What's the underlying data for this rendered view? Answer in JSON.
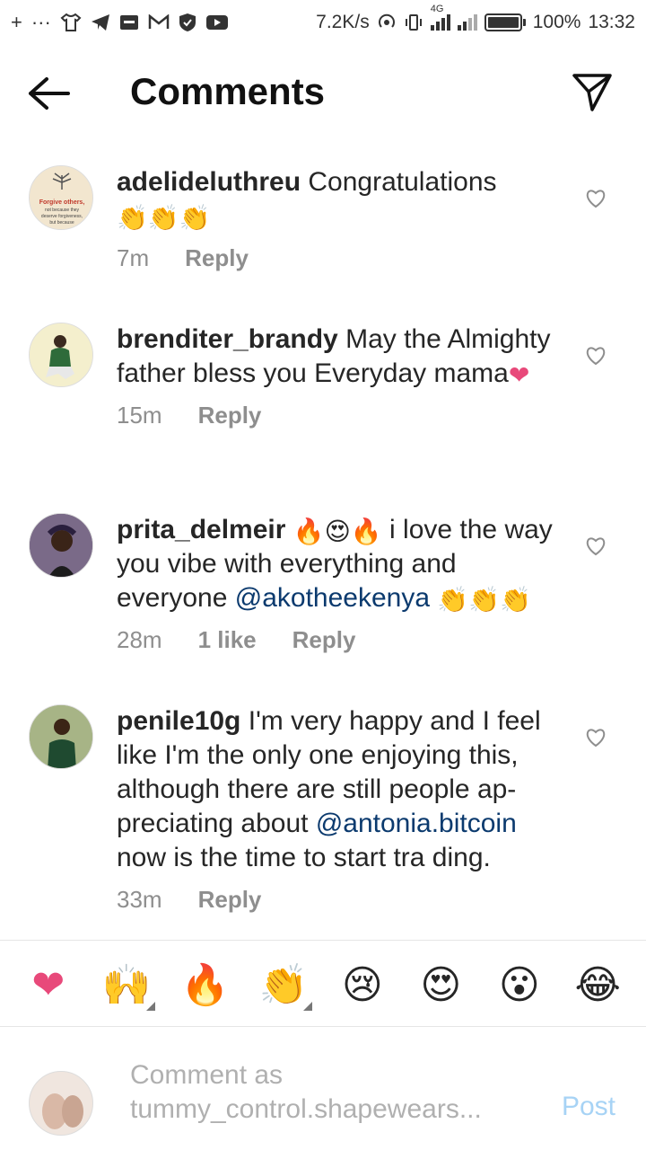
{
  "status_bar": {
    "net_speed": "7.2K/s",
    "network_type": "4G",
    "battery": "100%",
    "time": "13:32"
  },
  "header": {
    "title": "Comments"
  },
  "comments": [
    {
      "username": "adelideluthreu",
      "text": "Congratulations",
      "emojis_after": "👏👏👏",
      "time": "7m",
      "reply": "Reply",
      "avatar_lines": [
        "Forgive others,",
        "not because they",
        "deserve forgiveness,",
        "but because"
      ]
    },
    {
      "username": "brenditer_brandy",
      "text": "May the Almighty father bless you Everyday mama",
      "emojis_after": "❤",
      "time": "15m",
      "reply": "Reply"
    },
    {
      "username": "prita_delmeir",
      "emojis_lead": "🔥😍🔥",
      "text": "i love the way you vibe with everything and everyone",
      "mention": "@akotheekenya",
      "emojis_after": "👏👏👏",
      "time": "28m",
      "likes": "1 like",
      "reply": "Reply"
    },
    {
      "username": "penile10g",
      "text": "I'm very happy and I feel like I'm the only one enjoying this, although there are still people ap- preciating about",
      "mention": "@antonia.bitcoin",
      "text_after": "now is the time to start tra ding.",
      "time": "33m",
      "reply": "Reply"
    }
  ],
  "reactions": [
    "❤",
    "🙌",
    "🔥",
    "👏",
    "😢",
    "😍",
    "😮",
    "😂"
  ],
  "compose": {
    "placeholder": "Comment as tummy_control.shapewears...",
    "post_label": "Post"
  },
  "colors": {
    "mention": "#0b3a6e",
    "meta": "#8e8e8e",
    "post_disabled": "#a7d3f5",
    "heart_reaction": "#e8497a"
  }
}
